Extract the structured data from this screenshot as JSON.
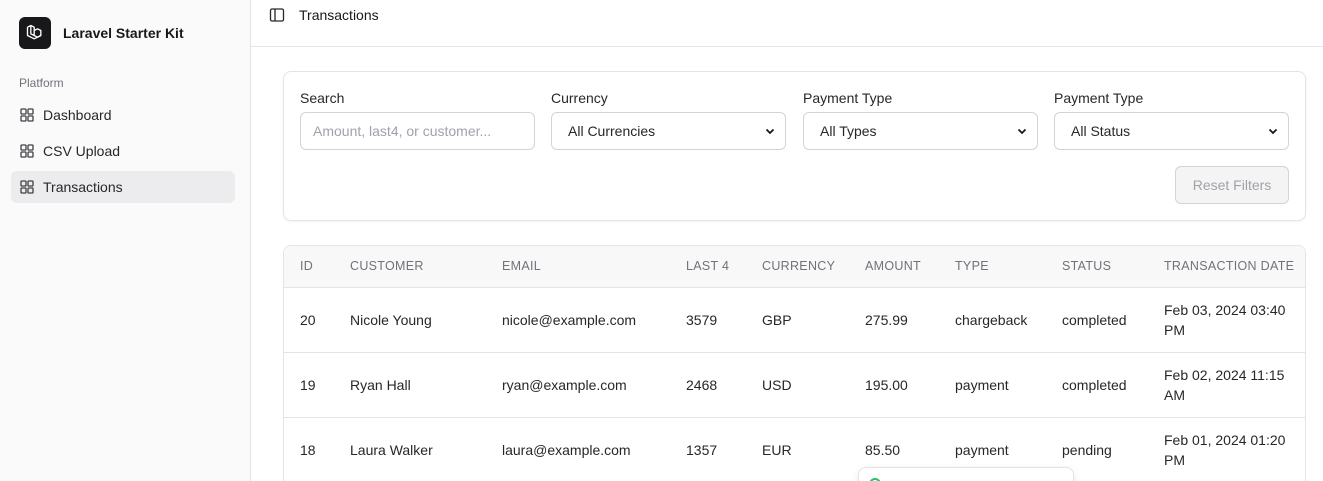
{
  "app": {
    "name": "Laravel Starter Kit"
  },
  "sidebar": {
    "group_label": "Platform",
    "items": [
      {
        "label": "Dashboard",
        "icon": "layout-grid-icon",
        "active": false
      },
      {
        "label": "CSV Upload",
        "icon": "layout-grid-icon",
        "active": false
      },
      {
        "label": "Transactions",
        "icon": "layout-grid-icon",
        "active": true
      }
    ]
  },
  "header": {
    "title": "Transactions",
    "toggle_icon": "sidebar-toggle-icon"
  },
  "filters": {
    "search": {
      "label": "Search",
      "placeholder": "Amount, last4, or customer...",
      "value": ""
    },
    "currency": {
      "label": "Currency",
      "selected": "All Currencies"
    },
    "payment_type": {
      "label": "Payment Type",
      "selected": "All Types"
    },
    "status": {
      "label": "Payment Type",
      "selected": "All Status"
    },
    "reset_label": "Reset Filters"
  },
  "table": {
    "columns": [
      "ID",
      "CUSTOMER",
      "EMAIL",
      "LAST 4",
      "CURRENCY",
      "AMOUNT",
      "TYPE",
      "STATUS",
      "TRANSACTION DATE"
    ],
    "rows": [
      [
        "20",
        "Nicole Young",
        "nicole@example.com",
        "3579",
        "GBP",
        "275.99",
        "chargeback",
        "completed",
        "Feb 03, 2024 03:40 PM"
      ],
      [
        "19",
        "Ryan Hall",
        "ryan@example.com",
        "2468",
        "USD",
        "195.00",
        "payment",
        "completed",
        "Feb 02, 2024 11:15 AM"
      ],
      [
        "18",
        "Laura Walker",
        "laura@example.com",
        "1357",
        "EUR",
        "85.50",
        "payment",
        "pending",
        "Feb 01, 2024 01:20 PM"
      ]
    ]
  },
  "colors": {
    "sidebar_bg": "#fafafa",
    "active_item_bg": "#ececee",
    "border": "#e4e4e7",
    "brand_logo_bg": "#18181b",
    "toast_accent": "#22c55e"
  }
}
